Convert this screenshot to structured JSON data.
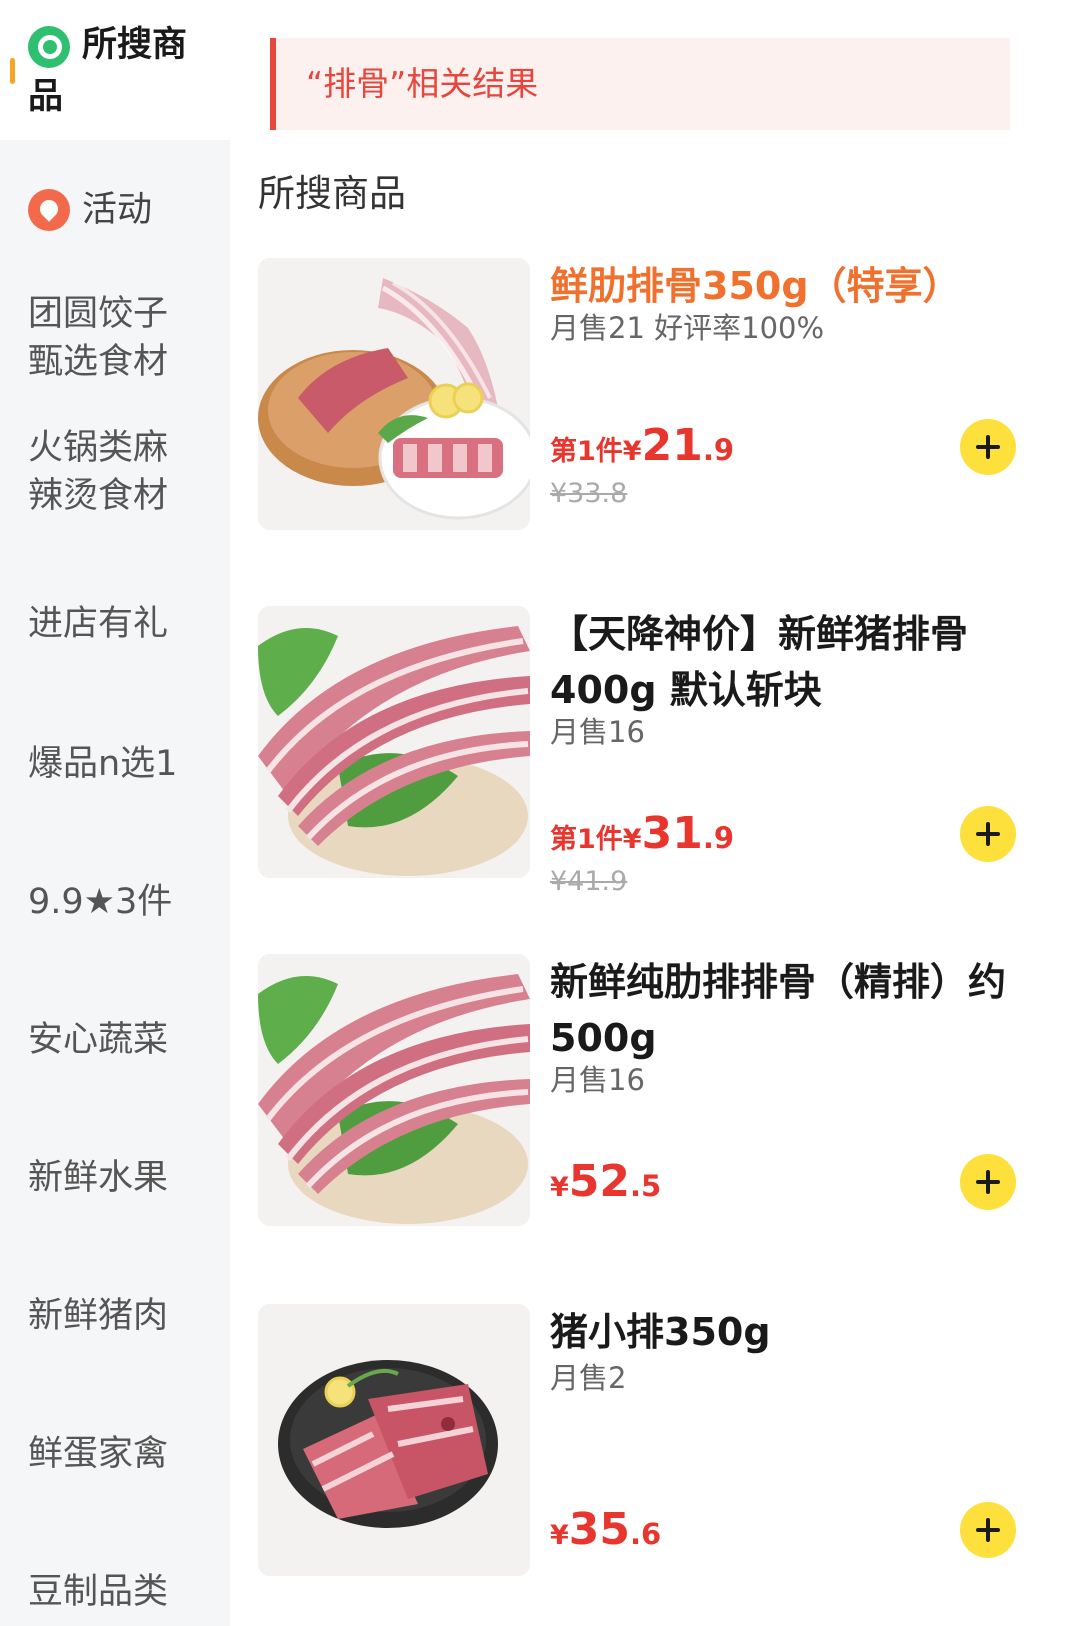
{
  "sidebar": {
    "items": [
      {
        "label_line1": "所搜商",
        "label_line2": "品",
        "icon": "search-icon",
        "active": true
      },
      {
        "label": "活动",
        "icon": "location-pin-icon"
      },
      {
        "label_line1": "团圆饺子",
        "label_line2": "甄选食材"
      },
      {
        "label_line1": "火锅类麻",
        "label_line2": "辣烫食材"
      },
      {
        "label": "进店有礼"
      },
      {
        "label": "爆品n选1"
      },
      {
        "label": "9.9★3件"
      },
      {
        "label": "安心蔬菜"
      },
      {
        "label": "新鲜水果"
      },
      {
        "label": "新鲜猪肉"
      },
      {
        "label": "鲜蛋家禽"
      },
      {
        "label": "豆制品类"
      }
    ]
  },
  "search": {
    "banner_text": "“排骨”相关结果"
  },
  "section_title": "所搜商品",
  "products": [
    {
      "name": "鲜肋排骨350g（特享）",
      "sales": "月售21  好评率100%",
      "price_prefix": "第1件¥",
      "price_int": "21",
      "price_dec": ".9",
      "original_price": "¥33.8"
    },
    {
      "name": "【天降神价】新鲜猪排骨400g 默认斩块",
      "sales": "月售16",
      "price_prefix": "第1件¥",
      "price_int": "31",
      "price_dec": ".9",
      "original_price": "¥41.9"
    },
    {
      "name": "新鲜纯肋排排骨（精排）约500g",
      "sales": "月售16",
      "price_prefix": "¥",
      "price_int": "52",
      "price_dec": ".5",
      "original_price": ""
    },
    {
      "name": "猪小排350g",
      "sales": "月售2",
      "price_prefix": "¥",
      "price_int": "35",
      "price_dec": ".6",
      "original_price": ""
    }
  ],
  "colors": {
    "accent_green": "#2fbf71",
    "price_red": "#e8362e",
    "highlight_orange": "#f0702d",
    "add_button_yellow": "#fde03b"
  }
}
